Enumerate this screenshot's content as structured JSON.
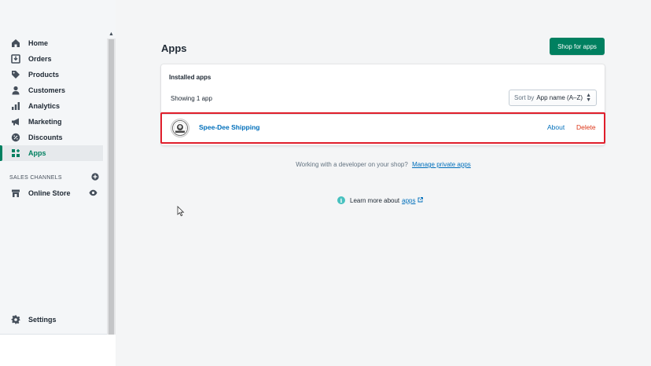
{
  "sidebar": {
    "items": [
      {
        "label": "Home",
        "icon": "home-icon"
      },
      {
        "label": "Orders",
        "icon": "orders-icon"
      },
      {
        "label": "Products",
        "icon": "tag-icon"
      },
      {
        "label": "Customers",
        "icon": "person-icon"
      },
      {
        "label": "Analytics",
        "icon": "bar-chart-icon"
      },
      {
        "label": "Marketing",
        "icon": "megaphone-icon"
      },
      {
        "label": "Discounts",
        "icon": "discount-icon"
      },
      {
        "label": "Apps",
        "icon": "apps-icon",
        "active": true
      }
    ],
    "sales_channels_label": "SALES CHANNELS",
    "online_store_label": "Online Store",
    "settings_label": "Settings"
  },
  "page": {
    "title": "Apps",
    "shop_button_label": "Shop for apps"
  },
  "installed": {
    "card_title": "Installed apps",
    "showing_text": "Showing 1 app",
    "sort_prefix": "Sort by",
    "sort_value": "App name (A–Z)",
    "apps": [
      {
        "name": "Spee-Dee Shipping",
        "about_label": "About",
        "delete_label": "Delete"
      }
    ]
  },
  "footer": {
    "developer_text": "Working with a developer on your shop?",
    "manage_link": "Manage private apps",
    "learn_text": "Learn more about",
    "learn_link": "apps"
  },
  "colors": {
    "accent": "#008060",
    "link": "#006fbb",
    "danger": "#de3618",
    "highlight": "#e01e2b"
  }
}
